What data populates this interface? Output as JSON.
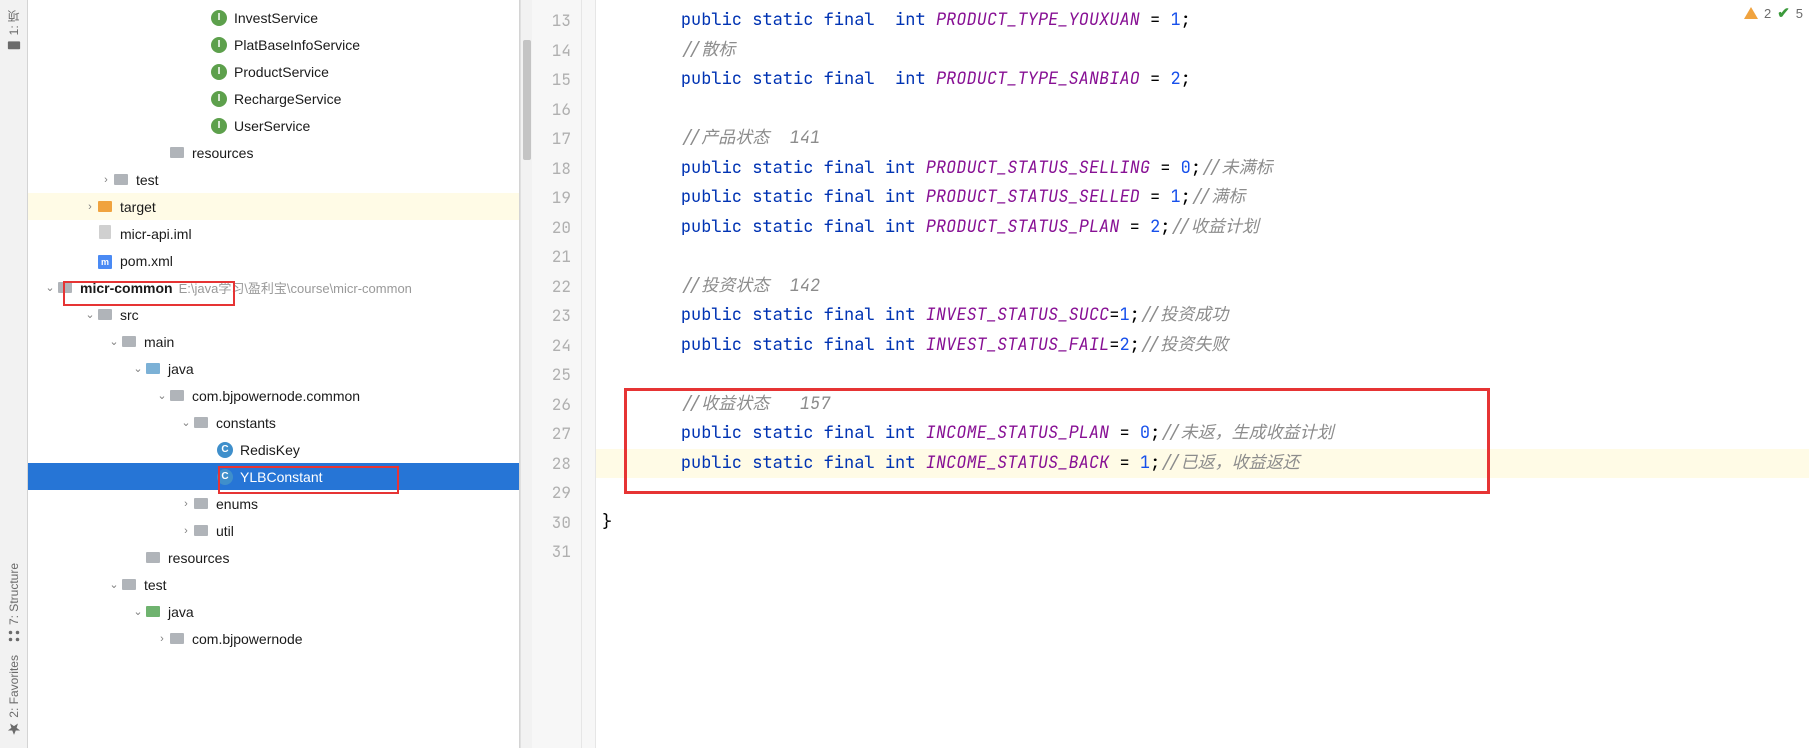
{
  "tool_strip": {
    "top": "1: 项",
    "structure": "7: Structure",
    "favorites": "2: Favorites"
  },
  "tree": [
    {
      "indent": 170,
      "arrow": "",
      "icon": "badge-i",
      "label": "InvestService"
    },
    {
      "indent": 170,
      "arrow": "",
      "icon": "badge-i",
      "label": "PlatBaseInfoService"
    },
    {
      "indent": 170,
      "arrow": "",
      "icon": "badge-i",
      "label": "ProductService"
    },
    {
      "indent": 170,
      "arrow": "",
      "icon": "badge-i",
      "label": "RechargeService"
    },
    {
      "indent": 170,
      "arrow": "",
      "icon": "badge-i",
      "label": "UserService"
    },
    {
      "indent": 128,
      "arrow": "",
      "icon": "folder",
      "label": "resources"
    },
    {
      "indent": 72,
      "arrow": "›",
      "icon": "folder",
      "label": "test"
    },
    {
      "indent": 56,
      "arrow": "›",
      "icon": "folder-orange",
      "label": "target",
      "hlrow": true
    },
    {
      "indent": 56,
      "arrow": "",
      "icon": "file-generic",
      "label": "micr-api.iml"
    },
    {
      "indent": 56,
      "arrow": "",
      "icon": "file-m",
      "label": "pom.xml"
    },
    {
      "indent": 16,
      "arrow": "⌄",
      "icon": "folder",
      "label": "micr-common",
      "bold": true,
      "hint": "E:\\java学习\\盈利宝\\course\\micr-common"
    },
    {
      "indent": 56,
      "arrow": "⌄",
      "icon": "folder",
      "label": "src"
    },
    {
      "indent": 80,
      "arrow": "⌄",
      "icon": "folder",
      "label": "main"
    },
    {
      "indent": 104,
      "arrow": "⌄",
      "icon": "folder-blue",
      "label": "java"
    },
    {
      "indent": 128,
      "arrow": "⌄",
      "icon": "folder",
      "label": "com.bjpowernode.common"
    },
    {
      "indent": 152,
      "arrow": "⌄",
      "icon": "folder",
      "label": "constants"
    },
    {
      "indent": 176,
      "arrow": "",
      "icon": "badge-c",
      "label": "RedisKey"
    },
    {
      "indent": 176,
      "arrow": "",
      "icon": "badge-c",
      "label": "YLBConstant",
      "selected": true
    },
    {
      "indent": 152,
      "arrow": "›",
      "icon": "folder",
      "label": "enums"
    },
    {
      "indent": 152,
      "arrow": "›",
      "icon": "folder",
      "label": "util"
    },
    {
      "indent": 104,
      "arrow": "",
      "icon": "folder",
      "label": "resources"
    },
    {
      "indent": 80,
      "arrow": "⌄",
      "icon": "folder",
      "label": "test"
    },
    {
      "indent": 104,
      "arrow": "⌄",
      "icon": "folder-green",
      "label": "java"
    },
    {
      "indent": 128,
      "arrow": "›",
      "icon": "folder",
      "label": "com.bjpowernode"
    }
  ],
  "gutter": [
    "13",
    "14",
    "15",
    "16",
    "17",
    "18",
    "19",
    "20",
    "21",
    "22",
    "23",
    "24",
    "25",
    "26",
    "27",
    "28",
    "29",
    "30",
    "31"
  ],
  "code": {
    "l13": {
      "pre": "    ",
      "kw": "public static final",
      "sp": "  ",
      "ty": "int",
      "id": "PRODUCT_TYPE_YOUXUAN",
      "eq": " = ",
      "val": "1",
      "tail": ";"
    },
    "l14": {
      "cmt": "    //散标"
    },
    "l15": {
      "pre": "    ",
      "kw": "public static final",
      "sp": "  ",
      "ty": "int",
      "id": "PRODUCT_TYPE_SANBIAO",
      "eq": " = ",
      "val": "2",
      "tail": ";"
    },
    "l16": {
      "blank": ""
    },
    "l17": {
      "cmt": "    //产品状态  141"
    },
    "l18": {
      "pre": "    ",
      "kw": "public static final",
      "sp": " ",
      "ty": "int",
      "id": "PRODUCT_STATUS_SELLING",
      "eq": " = ",
      "val": "0",
      "tail": ";",
      "cmt": "//未满标"
    },
    "l19": {
      "pre": "    ",
      "kw": "public static final",
      "sp": " ",
      "ty": "int",
      "id": "PRODUCT_STATUS_SELLED",
      "eq": " = ",
      "val": "1",
      "tail": ";",
      "cmt": "//满标"
    },
    "l20": {
      "pre": "    ",
      "kw": "public static final",
      "sp": " ",
      "ty": "int",
      "id": "PRODUCT_STATUS_PLAN",
      "eq": " = ",
      "val": "2",
      "tail": ";",
      "cmt": "//收益计划"
    },
    "l21": {
      "blank": ""
    },
    "l22": {
      "cmt": "    //投资状态  142"
    },
    "l23": {
      "pre": "    ",
      "kw": "public static final",
      "sp": " ",
      "ty": "int",
      "id": "INVEST_STATUS_SUCC",
      "eq": "=",
      "val": "1",
      "tail": ";",
      "cmt": "//投资成功"
    },
    "l24": {
      "pre": "    ",
      "kw": "public static final",
      "sp": " ",
      "ty": "int",
      "id": "INVEST_STATUS_FAIL",
      "eq": "=",
      "val": "2",
      "tail": ";",
      "cmt": "//投资失败"
    },
    "l25": {
      "blank": ""
    },
    "l26": {
      "cmt": "    //收益状态   157"
    },
    "l27": {
      "pre": "    ",
      "kw": "public static final",
      "sp": " ",
      "ty": "int",
      "id": "INCOME_STATUS_PLAN",
      "eq": " = ",
      "val": "0",
      "tail": ";",
      "cmt": "//未返，生成收益计划"
    },
    "l28": {
      "pre": "    ",
      "kw": "public static final",
      "sp": " ",
      "ty": "int",
      "id": "INCOME_STATUS_BACK",
      "eq": " = ",
      "val": "1",
      "tail": ";",
      "cmt": "//已返，收益返还"
    },
    "l29": {
      "blank": ""
    },
    "l30": {
      "brace": "}"
    },
    "l31": {
      "blank": ""
    }
  },
  "status": {
    "warn_count": "2",
    "check_count": "5"
  }
}
